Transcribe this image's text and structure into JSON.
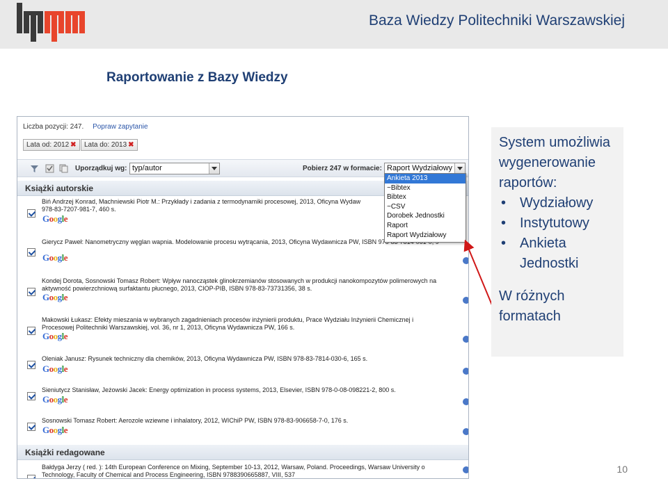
{
  "header": {
    "title": "Baza Wiedzy Politechniki Warszawskiej",
    "logo_name": "pw-logo"
  },
  "slide_title": "Raportowanie z Bazy Wiedzy",
  "report_ui": {
    "count_label": "Liczba pozycji: 247.",
    "correct_query_link": "Popraw zapytanie",
    "filters": [
      "Lata od: 2012",
      "Lata do: 2013"
    ],
    "sort_label": "Uporządkuj wg:",
    "sort_value": "typ/autor",
    "download_label": "Pobierz 247 w formacie:",
    "format_value": "Raport Wydziałowy",
    "format_options": [
      "Ankieta 2013",
      "~Bibtex",
      "Bibtex",
      "~CSV",
      "Dorobek Jednostki",
      "Raport",
      "Raport Wydziałowy"
    ],
    "selected_option": "Ankieta 2013",
    "sections": [
      "Książki autorskie",
      "Książki redagowane"
    ],
    "entries": [
      {
        "line1": "Biń Andrzej Konrad, Machniewski Piotr M.: Przykłady i zadania z termodynamiki procesowej, 2013, Oficyna Wydaw",
        "line2": "978-83-7207-981-7, 460 s."
      },
      {
        "line1": "Gierycz Paweł: Nanometryczny węglan wapnia. Modelowanie procesu wytrącania, 2013, Oficyna Wydawnicza PW, ISBN 978-83-7814-061-0, 9",
        "line2": ""
      },
      {
        "line1": "Kondej Dorota, Sosnowski Tomasz Robert: Wpływ nanocząstek glinokrzemianów stosowanych w produkcji nanokompozytów polimerowych na",
        "line2": "aktywność powierzchniową surfaktantu płucnego, 2013, CIOP-PIB, ISBN 978-83-73731356, 38 s."
      },
      {
        "line1": "Makowski Łukasz: Efekty mieszania w wybranych zagadnieniach procesów inżynierii produktu, Prace Wydziału Inżynierii Chemicznej i",
        "line2": "Procesowej Politechniki Warszawskiej, vol. 36, nr 1, 2013, Oficyna Wydawnicza PW, 166 s."
      },
      {
        "line1": "Oleniak Janusz: Rysunek techniczny dla chemików, 2013, Oficyna Wydawnicza PW, ISBN 978-83-7814-030-6, 165 s.",
        "line2": ""
      },
      {
        "line1": "Sieniutycz Stanisław, Jeżowski Jacek: Energy optimization in process systems, 2013, Elsevier, ISBN 978-0-08-098221-2, 800 s.",
        "line2": ""
      },
      {
        "line1": "Sosnowski Tomasz Robert: Aerozole wziewne i inhalatory, 2012, WIChiP PW, ISBN 978-83-906658-7-0, 176 s.",
        "line2": ""
      },
      {
        "line1": "Bałdyga Jerzy ( red. ): 14th European Conference on Mixing, September 10-13, 2012, Warsaw, Poland. Proceedings, Warsaw University o",
        "line2": "Technology, Faculty of Chemical and Process Engineering, ISBN 9788390665887, VIII, 537"
      }
    ],
    "google_text": "Google"
  },
  "callout": {
    "intro": "System umożliwia wygenerowanie raportów:",
    "items": [
      "Wydziałowy",
      "Instytutowy",
      "Ankieta Jednostki"
    ],
    "outro": "W różnych formatach"
  },
  "page_number": "10",
  "colors": {
    "accent_blue": "#1f3f74",
    "logo_red": "#e8452c",
    "logo_dark": "#3a3a3a",
    "arrow_red": "#d01818"
  }
}
